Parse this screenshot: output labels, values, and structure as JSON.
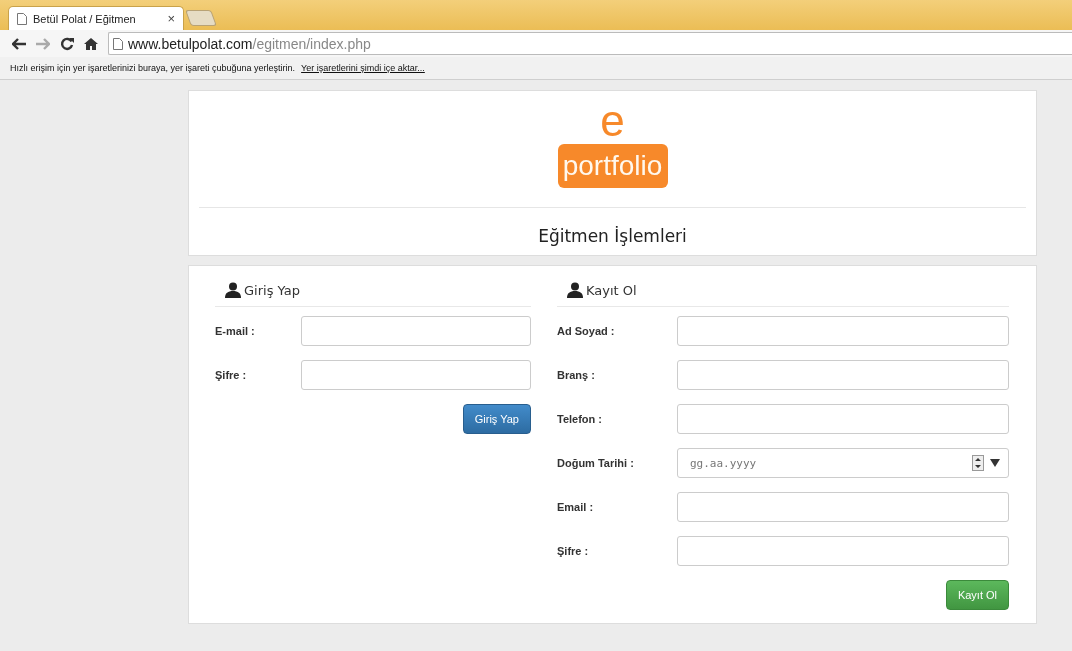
{
  "browser": {
    "tab_title": "Betül Polat / Eğitmen",
    "tab_close": "×",
    "url_host": "www.betulpolat.com",
    "url_path": "/egitmen/index.php",
    "bookmarks_hint": "Hızlı erişim için yer işaretlerinizi buraya, yer işareti çubuğuna yerleştirin.",
    "bookmarks_link": "Yer işaretlerini şimdi içe aktar..."
  },
  "logo": {
    "letter": "e",
    "word": "portfolio"
  },
  "header": {
    "title": "Eğitmen İşlemleri"
  },
  "login": {
    "title": "Giriş Yap",
    "fields": [
      {
        "label": "E-mail :",
        "kind": "text"
      },
      {
        "label": "Şifre :",
        "kind": "text"
      }
    ],
    "button": "Giriş Yap"
  },
  "register": {
    "title": "Kayıt Ol",
    "fields": [
      {
        "label": "Ad Soyad :",
        "kind": "text"
      },
      {
        "label": "Branş :",
        "kind": "text"
      },
      {
        "label": "Telefon :",
        "kind": "text"
      },
      {
        "label": "Doğum Tarihi :",
        "kind": "date",
        "placeholder": "gg.aa.yyyy"
      },
      {
        "label": "Email :",
        "kind": "text"
      },
      {
        "label": "Şifre :",
        "kind": "text"
      }
    ],
    "button": "Kayıt Ol"
  }
}
